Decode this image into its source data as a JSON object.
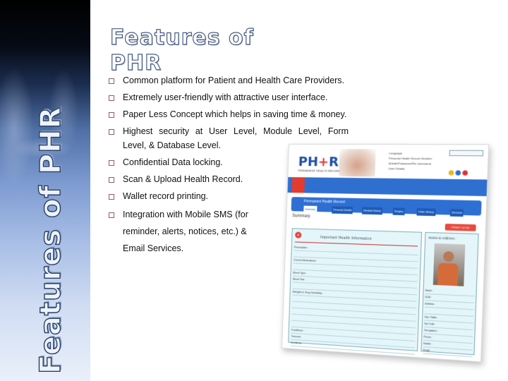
{
  "slide": {
    "side_title": "Features of PHR",
    "title_line1": "Features of",
    "title_line2": "PHR",
    "bullets": [
      "Common platform for Patient and Health Care Providers.",
      "Extremely user-friendly with attractive user interface.",
      "Paper Less Concept which helps in saving time & money.",
      "Highest security at User Level, Module Level, Form Level, & Database Level.",
      "Confidential Data locking.",
      "Scan & Upload Health Record.",
      "Wallet record printing.",
      "Integration with Mobile SMS (for reminder, alerts, notices, etc.) & Email Services."
    ],
    "colors": {
      "bullet_border": "#9a5a5a",
      "text": "#111111",
      "sidebar_top": "#000000",
      "sidebar_bottom": "#eaf0fa"
    }
  },
  "screenshot": {
    "logo_left": "PH",
    "logo_plus": "+",
    "logo_right": "R",
    "logo_subtitle": "PERMANENT HEALTH RECORD",
    "meta_labels": [
      "Language",
      "Personal Health Record Number",
      "Mobile/Password/Pin Username",
      "User Details"
    ],
    "nav_title": "Permanent Health Record",
    "subtabs": [
      "Summary",
      "Personal Details",
      "Medical History",
      "Surgery",
      "Other History",
      "Services"
    ],
    "summary_label": "Summary",
    "print_button": "PRINT VIEW",
    "info_title": "Important Health Information",
    "info_rows": [
      "Prescription :",
      "",
      "Current Medications :",
      "",
      "Blood Type :",
      "Blood Test :",
      "",
      "Allergies & Drug Sensitivity :",
      "",
      "",
      "",
      "",
      "",
      "Conditions :",
      "Tumours :",
      "Accidents :"
    ],
    "address_title": "Name & Address :",
    "address_rows": [
      "Name :",
      "DOB :",
      "Address :",
      "",
      "City / State :",
      "Zip Code :",
      "Occupation :",
      "Phone :",
      "Mobile :",
      "Email :"
    ],
    "brand_colors": {
      "nav_blue": "#2f6fd0",
      "accent_red": "#e33b2e",
      "panel_bg": "#e4f6f9"
    }
  }
}
